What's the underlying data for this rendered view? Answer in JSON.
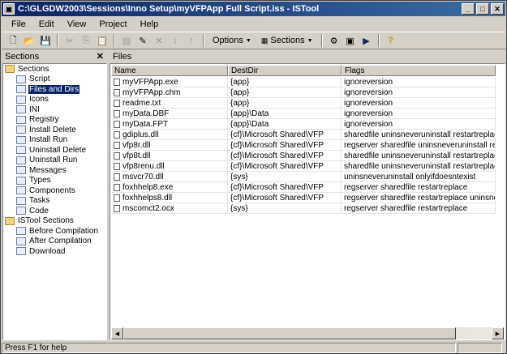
{
  "window": {
    "title": "C:\\GLGDW2003\\Sessions\\Inno Setup\\myVFPApp Full Script.iss - ISTool"
  },
  "menu": [
    "File",
    "Edit",
    "View",
    "Project",
    "Help"
  ],
  "toolbar": {
    "options_label": "Options",
    "sections_label": "Sections"
  },
  "sections_panel": {
    "header": "Sections",
    "groups": [
      {
        "label": "Sections",
        "items": [
          {
            "label": "Script",
            "icon": "script-icon"
          },
          {
            "label": "Files and Dirs",
            "icon": "files-icon",
            "selected": true
          },
          {
            "label": "Icons",
            "icon": "icons-icon"
          },
          {
            "label": "INI",
            "icon": "ini-icon"
          },
          {
            "label": "Registry",
            "icon": "registry-icon"
          },
          {
            "label": "Install Delete",
            "icon": "install-delete-icon"
          },
          {
            "label": "Install Run",
            "icon": "install-run-icon"
          },
          {
            "label": "Uninstall Delete",
            "icon": "uninstall-delete-icon"
          },
          {
            "label": "Uninstall Run",
            "icon": "uninstall-run-icon"
          },
          {
            "label": "Messages",
            "icon": "messages-icon"
          },
          {
            "label": "Types",
            "icon": "types-icon"
          },
          {
            "label": "Components",
            "icon": "components-icon"
          },
          {
            "label": "Tasks",
            "icon": "tasks-icon"
          },
          {
            "label": "Code",
            "icon": "code-icon"
          }
        ]
      },
      {
        "label": "ISTool Sections",
        "items": [
          {
            "label": "Before Compilation",
            "icon": "before-compilation-icon"
          },
          {
            "label": "After Compilation",
            "icon": "after-compilation-icon"
          },
          {
            "label": "Download",
            "icon": "download-icon"
          }
        ]
      }
    ]
  },
  "files_panel": {
    "header": "Files",
    "columns": [
      "Name",
      "DestDir",
      "Flags"
    ],
    "rows": [
      [
        "myVFPApp.exe",
        "{app}",
        "ignoreversion"
      ],
      [
        "myVFPApp.chm",
        "{app}",
        "ignoreversion"
      ],
      [
        "readme.txt",
        "{app}",
        "ignoreversion"
      ],
      [
        "myData.DBF",
        "{app}\\Data",
        "ignoreversion"
      ],
      [
        "myData.FPT",
        "{app}\\Data",
        "ignoreversion"
      ],
      [
        "gdiplus.dll",
        "{cf}\\Microsoft Shared\\VFP",
        "sharedfile uninsneveruninstall restartreplace"
      ],
      [
        "vfp8r.dll",
        "{cf}\\Microsoft Shared\\VFP",
        "regserver sharedfile uninsneveruninstall restartreplace"
      ],
      [
        "vfp8t.dll",
        "{cf}\\Microsoft Shared\\VFP",
        "sharedfile uninsneveruninstall restartreplace"
      ],
      [
        "vfp8renu.dll",
        "{cf}\\Microsoft Shared\\VFP",
        "sharedfile uninsneveruninstall restartreplace"
      ],
      [
        "msvcr70.dll",
        "{sys}",
        "uninsneveruninstall onlyifdoesntexist"
      ],
      [
        "foxhhelp8.exe",
        "{cf}\\Microsoft Shared\\VFP",
        "regserver sharedfile restartreplace"
      ],
      [
        "foxhhelps8.dll",
        "{cf}\\Microsoft Shared\\VFP",
        "regserver sharedfile restartreplace uninsneveruninstall"
      ],
      [
        "mscomct2.ocx",
        "{sys}",
        "regserver sharedfile restartreplace"
      ]
    ]
  },
  "status": {
    "text": "Press F1 for help"
  }
}
